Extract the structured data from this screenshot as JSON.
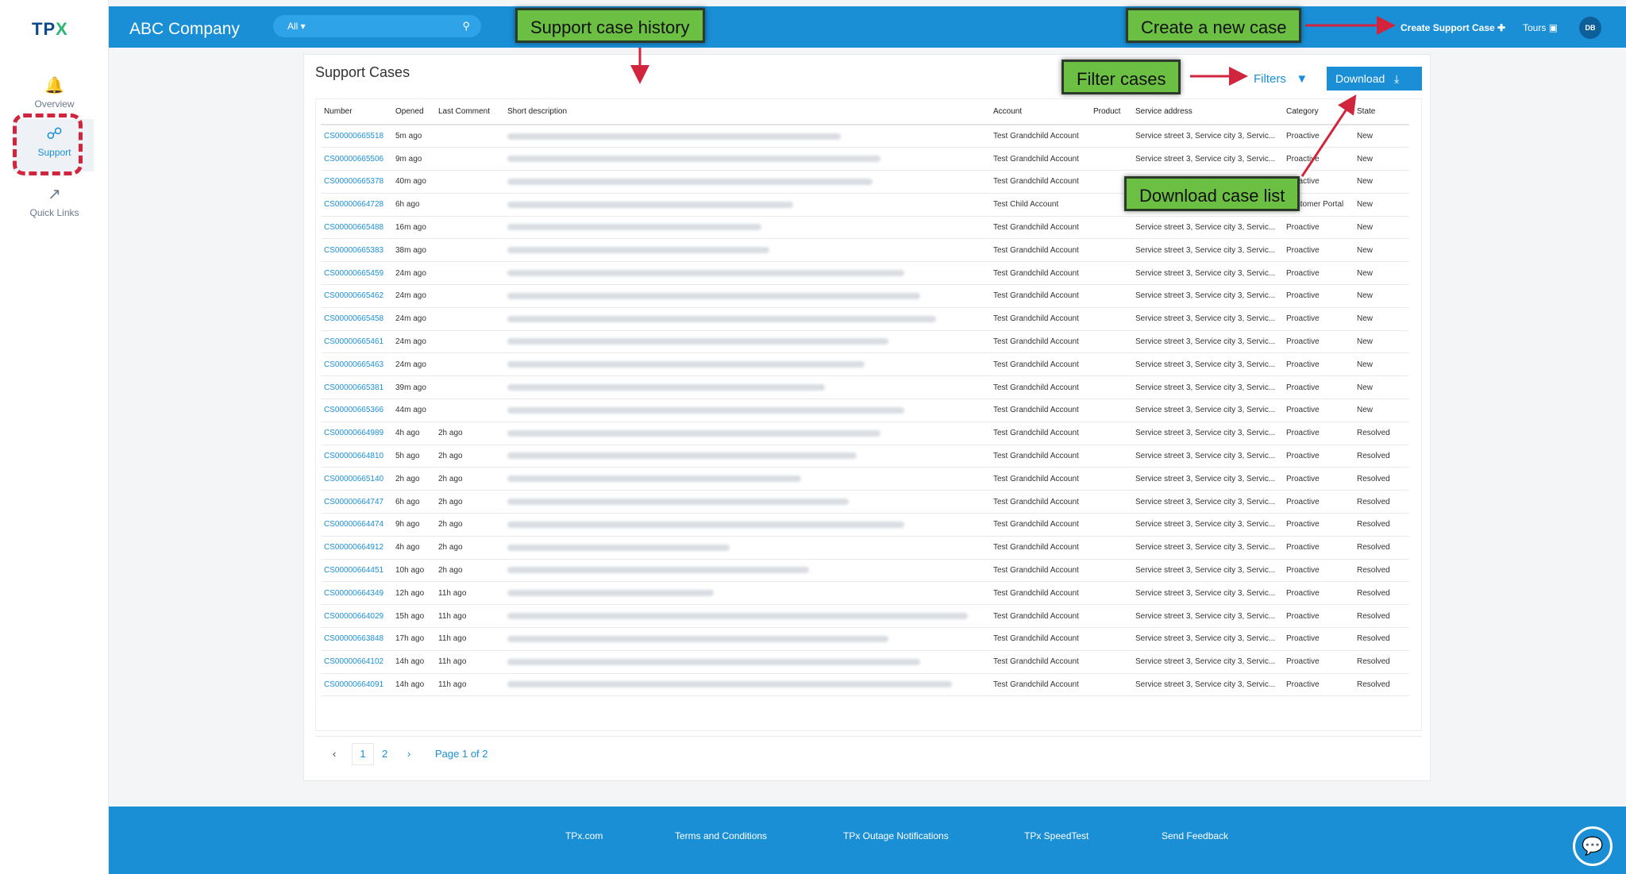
{
  "sidebar": {
    "logo_main": "TP",
    "logo_x": "X",
    "items": [
      {
        "label": "Overview",
        "icon": "bell-icon"
      },
      {
        "label": "Support",
        "icon": "lifebuoy-icon"
      },
      {
        "label": "Quick Links",
        "icon": "external-link-icon"
      }
    ]
  },
  "header": {
    "company": "ABC Company",
    "search_scope": "All ▾",
    "create_case": "Create Support Case ✚",
    "tours": "Tours",
    "avatar": "DB"
  },
  "main": {
    "title": "Support Cases",
    "filters_label": "Filters",
    "download_label": "Download",
    "columns": [
      "Number",
      "Opened",
      "Last Comment",
      "Short description",
      "Account",
      "Product",
      "Service address",
      "Category",
      "State"
    ],
    "rows": [
      {
        "number": "CS00000665518",
        "opened": "5m ago",
        "last_comment": "",
        "account": "Test Grandchild Account",
        "product": "",
        "address": "Service street 3, Service city 3, Servic...",
        "category": "Proactive",
        "state": "New"
      },
      {
        "number": "CS00000665506",
        "opened": "9m ago",
        "last_comment": "",
        "account": "Test Grandchild Account",
        "product": "",
        "address": "Service street 3, Service city 3, Servic...",
        "category": "Proactive",
        "state": "New"
      },
      {
        "number": "CS00000665378",
        "opened": "40m ago",
        "last_comment": "",
        "account": "Test Grandchild Account",
        "product": "",
        "address": "Service street 3, Service city 3, Servic...",
        "category": "Proactive",
        "state": "New"
      },
      {
        "number": "CS00000664728",
        "opened": "6h ago",
        "last_comment": "",
        "account": "Test Child Account",
        "product": "",
        "address": "",
        "category": "Customer Portal",
        "state": "New"
      },
      {
        "number": "CS00000665488",
        "opened": "16m ago",
        "last_comment": "",
        "account": "Test Grandchild Account",
        "product": "",
        "address": "Service street 3, Service city 3, Servic...",
        "category": "Proactive",
        "state": "New"
      },
      {
        "number": "CS00000665383",
        "opened": "38m ago",
        "last_comment": "",
        "account": "Test Grandchild Account",
        "product": "",
        "address": "Service street 3, Service city 3, Servic...",
        "category": "Proactive",
        "state": "New"
      },
      {
        "number": "CS00000665459",
        "opened": "24m ago",
        "last_comment": "",
        "account": "Test Grandchild Account",
        "product": "",
        "address": "Service street 3, Service city 3, Servic...",
        "category": "Proactive",
        "state": "New"
      },
      {
        "number": "CS00000665462",
        "opened": "24m ago",
        "last_comment": "",
        "account": "Test Grandchild Account",
        "product": "",
        "address": "Service street 3, Service city 3, Servic...",
        "category": "Proactive",
        "state": "New"
      },
      {
        "number": "CS00000665458",
        "opened": "24m ago",
        "last_comment": "",
        "account": "Test Grandchild Account",
        "product": "",
        "address": "Service street 3, Service city 3, Servic...",
        "category": "Proactive",
        "state": "New"
      },
      {
        "number": "CS00000665461",
        "opened": "24m ago",
        "last_comment": "",
        "account": "Test Grandchild Account",
        "product": "",
        "address": "Service street 3, Service city 3, Servic...",
        "category": "Proactive",
        "state": "New"
      },
      {
        "number": "CS00000665463",
        "opened": "24m ago",
        "last_comment": "",
        "account": "Test Grandchild Account",
        "product": "",
        "address": "Service street 3, Service city 3, Servic...",
        "category": "Proactive",
        "state": "New"
      },
      {
        "number": "CS00000665381",
        "opened": "39m ago",
        "last_comment": "",
        "account": "Test Grandchild Account",
        "product": "",
        "address": "Service street 3, Service city 3, Servic...",
        "category": "Proactive",
        "state": "New"
      },
      {
        "number": "CS00000665366",
        "opened": "44m ago",
        "last_comment": "",
        "account": "Test Grandchild Account",
        "product": "",
        "address": "Service street 3, Service city 3, Servic...",
        "category": "Proactive",
        "state": "New"
      },
      {
        "number": "CS00000664989",
        "opened": "4h ago",
        "last_comment": "2h ago",
        "account": "Test Grandchild Account",
        "product": "",
        "address": "Service street 3, Service city 3, Servic...",
        "category": "Proactive",
        "state": "Resolved"
      },
      {
        "number": "CS00000664810",
        "opened": "5h ago",
        "last_comment": "2h ago",
        "account": "Test Grandchild Account",
        "product": "",
        "address": "Service street 3, Service city 3, Servic...",
        "category": "Proactive",
        "state": "Resolved"
      },
      {
        "number": "CS00000665140",
        "opened": "2h ago",
        "last_comment": "2h ago",
        "account": "Test Grandchild Account",
        "product": "",
        "address": "Service street 3, Service city 3, Servic...",
        "category": "Proactive",
        "state": "Resolved"
      },
      {
        "number": "CS00000664747",
        "opened": "6h ago",
        "last_comment": "2h ago",
        "account": "Test Grandchild Account",
        "product": "",
        "address": "Service street 3, Service city 3, Servic...",
        "category": "Proactive",
        "state": "Resolved"
      },
      {
        "number": "CS00000664474",
        "opened": "9h ago",
        "last_comment": "2h ago",
        "account": "Test Grandchild Account",
        "product": "",
        "address": "Service street 3, Service city 3, Servic...",
        "category": "Proactive",
        "state": "Resolved"
      },
      {
        "number": "CS00000664912",
        "opened": "4h ago",
        "last_comment": "2h ago",
        "account": "Test Grandchild Account",
        "product": "",
        "address": "Service street 3, Service city 3, Servic...",
        "category": "Proactive",
        "state": "Resolved"
      },
      {
        "number": "CS00000664451",
        "opened": "10h ago",
        "last_comment": "2h ago",
        "account": "Test Grandchild Account",
        "product": "",
        "address": "Service street 3, Service city 3, Servic...",
        "category": "Proactive",
        "state": "Resolved"
      },
      {
        "number": "CS00000664349",
        "opened": "12h ago",
        "last_comment": "11h ago",
        "account": "Test Grandchild Account",
        "product": "",
        "address": "Service street 3, Service city 3, Servic...",
        "category": "Proactive",
        "state": "Resolved"
      },
      {
        "number": "CS00000664029",
        "opened": "15h ago",
        "last_comment": "11h ago",
        "account": "Test Grandchild Account",
        "product": "",
        "address": "Service street 3, Service city 3, Servic...",
        "category": "Proactive",
        "state": "Resolved"
      },
      {
        "number": "CS00000663848",
        "opened": "17h ago",
        "last_comment": "11h ago",
        "account": "Test Grandchild Account",
        "product": "",
        "address": "Service street 3, Service city 3, Servic...",
        "category": "Proactive",
        "state": "Resolved"
      },
      {
        "number": "CS00000664102",
        "opened": "14h ago",
        "last_comment": "11h ago",
        "account": "Test Grandchild Account",
        "product": "",
        "address": "Service street 3, Service city 3, Servic...",
        "category": "Proactive",
        "state": "Resolved"
      },
      {
        "number": "CS00000664091",
        "opened": "14h ago",
        "last_comment": "11h ago",
        "account": "Test Grandchild Account",
        "product": "",
        "address": "Service street 3, Service city 3, Servic...",
        "category": "Proactive",
        "state": "Resolved"
      }
    ],
    "pagination": {
      "prev": "‹",
      "pages": [
        "1",
        "2"
      ],
      "next": "›",
      "info": "Page 1 of 2"
    }
  },
  "footer": {
    "links": [
      "TPx.com",
      "Terms and Conditions",
      "TPx Outage Notifications",
      "TPx SpeedTest",
      "Send Feedback"
    ]
  },
  "annotations": {
    "history": "Support case history",
    "create": "Create a new case",
    "filter": "Filter cases",
    "download": "Download case list"
  },
  "colors": {
    "brand_blue": "#1a8fd6",
    "callout_green": "#6bbf43",
    "arrow_red": "#d1253e"
  }
}
